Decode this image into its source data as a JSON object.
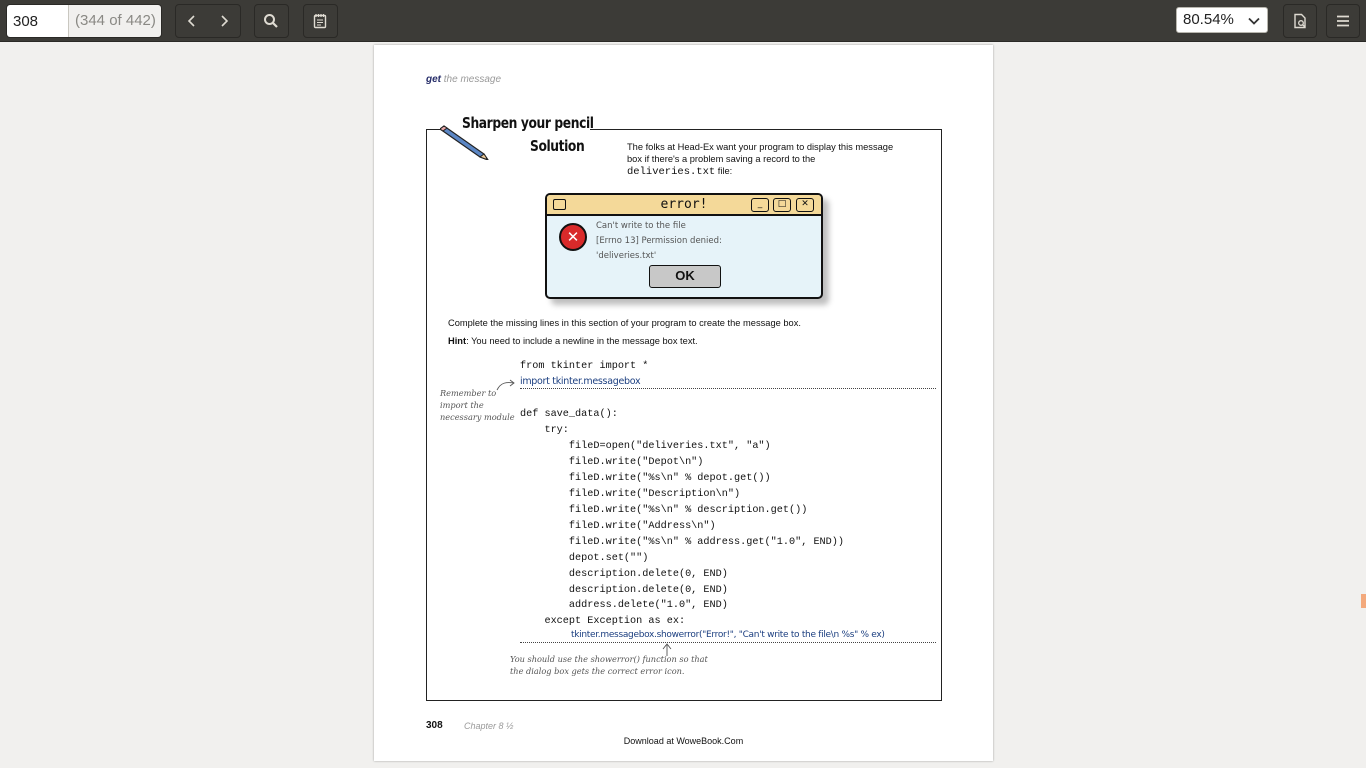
{
  "toolbar": {
    "page_number": "308",
    "page_count": "(344 of 442)",
    "prev_icon": "chevron-left-icon",
    "next_icon": "chevron-right-icon",
    "search_icon": "search-icon",
    "annotations_icon": "annotations-icon",
    "zoom": "80.54%",
    "document_icon": "document-properties-icon",
    "menu_icon": "hamburger-menu-icon"
  },
  "page": {
    "running_head_bold": "get",
    "running_head_rest": " the message",
    "sharpen_line1": "Sharpen your pencil",
    "sharpen_line2": "Solution",
    "intro_text": "The folks at Head-Ex want your program to display this message box if there's a problem saving a record to the",
    "intro_code": "deliveries.txt",
    "intro_suffix": " file:",
    "dialog": {
      "title": "error!",
      "line1": "Can't write to the file",
      "line2": "[Errno 13] Permission denied:",
      "line3": "'deliveries.txt'",
      "ok": "OK"
    },
    "instruction": "Complete the missing lines in this section of your program to create the message box.",
    "hint_label": "Hint",
    "hint_text": ": You need to include a newline in the message box text.",
    "code": [
      "from tkinter import *",
      "def save_data():",
      "    try:",
      "        fileD=open(\"deliveries.txt\", \"a\")",
      "        fileD.write(\"Depot\\n\")",
      "        fileD.write(\"%s\\n\" % depot.get())",
      "        fileD.write(\"Description\\n\")",
      "        fileD.write(\"%s\\n\" % description.get())",
      "        fileD.write(\"Address\\n\")",
      "        fileD.write(\"%s\\n\" % address.get(\"1.0\", END))",
      "        depot.set(\"\")",
      "        description.delete(0, END)",
      "        description.delete(0, END)",
      "        address.delete(\"1.0\", END)",
      "    except Exception as ex:"
    ],
    "handwritten_import": "import tkinter.messagebox",
    "handwritten_showerror": "tkinter.messagebox.showerror(\"Error!\", \"Can't write to the file\\n %s\" % ex)",
    "note_import": [
      "Remember to",
      "import the",
      "necessary module"
    ],
    "note_showerror": [
      "You should use the showerror() function so that",
      "the dialog box gets the correct error icon."
    ],
    "folio": "308",
    "chapter": "Chapter 8 ½",
    "download": "Download at WoweBook.Com"
  }
}
